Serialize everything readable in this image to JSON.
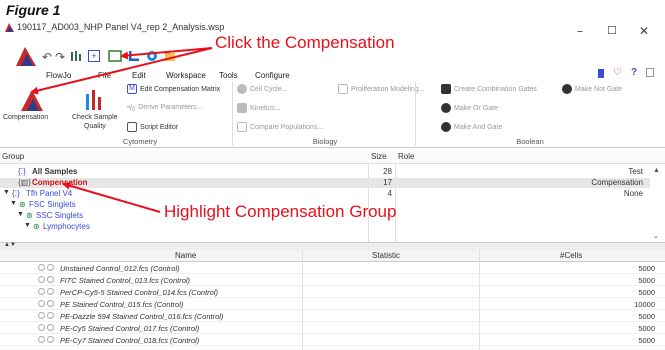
{
  "figure_label": "Figure 1",
  "window": {
    "title": "190117_AD003_NHP Panel V4_rep 2_Analysis.wsp",
    "minimize": "–",
    "maximize": "☐",
    "close": "✕"
  },
  "menu_tabs": [
    "FlowJo",
    "File",
    "Edit",
    "Workspace",
    "Tools",
    "Configure"
  ],
  "ribbon": {
    "cytometry": {
      "label": "Cytometry",
      "compensation": "Compensation",
      "check_sample_quality_1": "Check Sample",
      "check_sample_quality_2": "Quality",
      "edit_comp_matrix": "Edit Compensation Matrix",
      "derive_parameters": "Derive Parameters...",
      "script_editor": "Script Editor"
    },
    "biology": {
      "label": "Biology",
      "cell_cycle": "Cell Cycle...",
      "kinetics": "Kinetics...",
      "compare_populations": "Compare Populations...",
      "proliferation_modeling": "Proliferation Modeling..."
    },
    "boolean": {
      "label": "Boolean",
      "create_combination_gates": "Create Combination Gates",
      "make_not_gate": "Make Not Gate",
      "make_or_gate": "Make Or Gate",
      "make_and_gate": "Make And Gate"
    }
  },
  "groups": {
    "headers": {
      "group": "Group",
      "size": "Size",
      "role": "Role"
    },
    "rows": [
      {
        "name": "All Samples",
        "size": "28",
        "role": "Test"
      },
      {
        "name": "Compensation",
        "size": "17",
        "role": "Compensation"
      },
      {
        "name": "Tfh Panel V4",
        "size": "4",
        "role": "None"
      },
      {
        "name": "FSC Singlets",
        "size": "",
        "role": ""
      },
      {
        "name": "SSC Singlets",
        "size": "",
        "role": ""
      },
      {
        "name": "Lymphocytes",
        "size": "",
        "role": ""
      }
    ]
  },
  "samples": {
    "headers": {
      "name": "Name",
      "statistic": "Statistic",
      "cells": "#Cells"
    },
    "rows": [
      {
        "name": "Unstained Control_012.fcs (Control)",
        "cells": "5000"
      },
      {
        "name": "FITC Stained Control_013.fcs (Control)",
        "cells": "5000"
      },
      {
        "name": "PerCP-Cy5-5 Stained Control_014.fcs (Control)",
        "cells": "5000"
      },
      {
        "name": "PE Stained Control_015.fcs (Control)",
        "cells": "10000"
      },
      {
        "name": "PE-Dazzle 594 Stained Control_016.fcs (Control)",
        "cells": "5000"
      },
      {
        "name": "PE-Cy5 Stained Control_017.fcs (Control)",
        "cells": "5000"
      },
      {
        "name": "PE-Cy7 Stained Control_018.fcs (Control)",
        "cells": "5000"
      }
    ]
  },
  "annotations": {
    "click_compensation": "Click the Compensation",
    "highlight_group": "Highlight Compensation Group"
  },
  "colors": {
    "annotation_red": "#e8101c",
    "group_blue": "#3b4bd8",
    "selected_red": "#d01010"
  }
}
